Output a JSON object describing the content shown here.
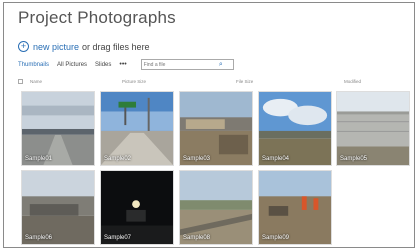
{
  "title": "Project Photographs",
  "new_item": {
    "link": "new picture",
    "suffix": "or drag files here"
  },
  "views": {
    "thumbnails": "Thumbnails",
    "all_pictures": "All Pictures",
    "slides": "Slides",
    "more": "•••"
  },
  "search": {
    "placeholder": "Find a file"
  },
  "columns": {
    "name": "Name",
    "picture_size": "Picture Size",
    "file_size": "File Size",
    "modified": "Modified"
  },
  "photos": [
    {
      "label": "Sample01"
    },
    {
      "label": "Sample02"
    },
    {
      "label": "Sample03"
    },
    {
      "label": "Sample04"
    },
    {
      "label": "Sample05"
    },
    {
      "label": "Sample06"
    },
    {
      "label": "Sample07"
    },
    {
      "label": "Sample08"
    },
    {
      "label": "Sample09"
    }
  ],
  "colors": {
    "accent": "#2a6fb5"
  }
}
